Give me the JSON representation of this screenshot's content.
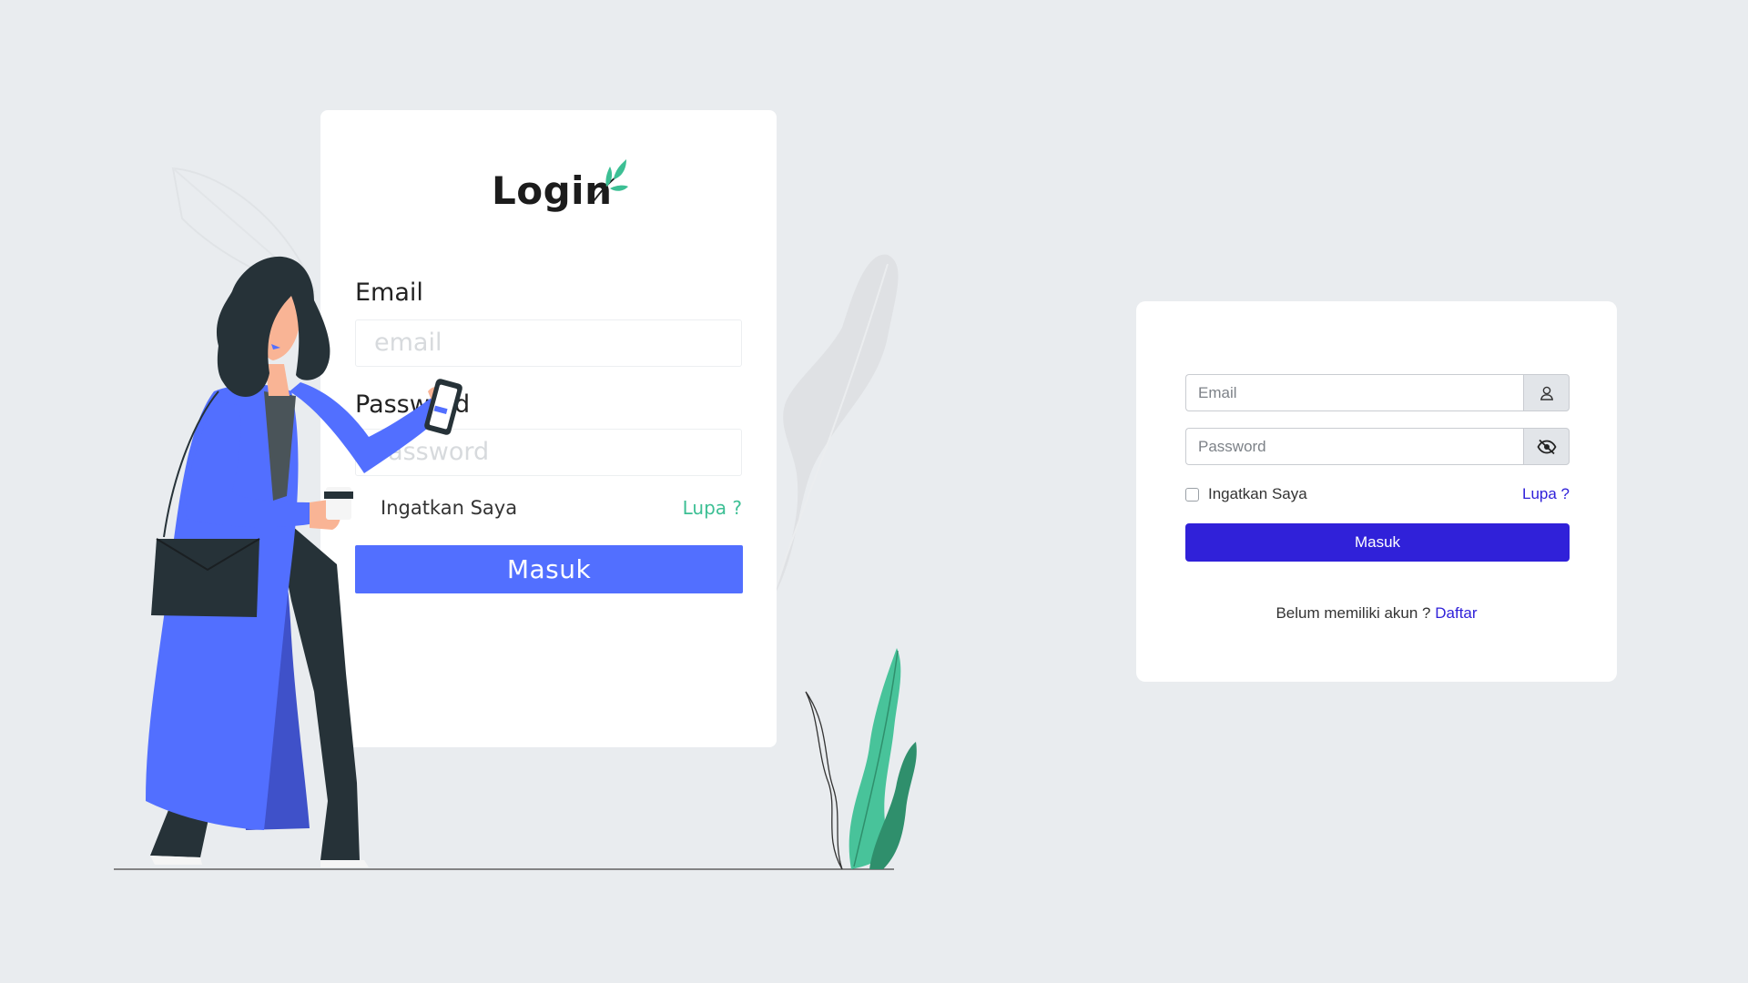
{
  "illustration": {
    "logo_text": "Login",
    "email_label": "Email",
    "email_placeholder": "email",
    "password_label": "Password",
    "password_placeholder": "Password",
    "remember_label": "Ingatkan Saya",
    "forgot_label": "Lupa ?",
    "submit_label": "Masuk"
  },
  "login": {
    "email_placeholder": "Email",
    "password_placeholder": "Password",
    "remember_label": "Ingatkan Saya",
    "forgot_label": "Lupa ?",
    "submit_label": "Masuk",
    "register_prompt": "Belum memiliki akun ?",
    "register_link": "Daftar"
  },
  "icons": {
    "email_addon": "user-icon",
    "password_addon": "eye-slash-icon"
  },
  "colors": {
    "background": "#e9ecef",
    "illustration_accent": "#526fff",
    "leaf_green": "#3cbf94",
    "primary": "#3021d9"
  }
}
